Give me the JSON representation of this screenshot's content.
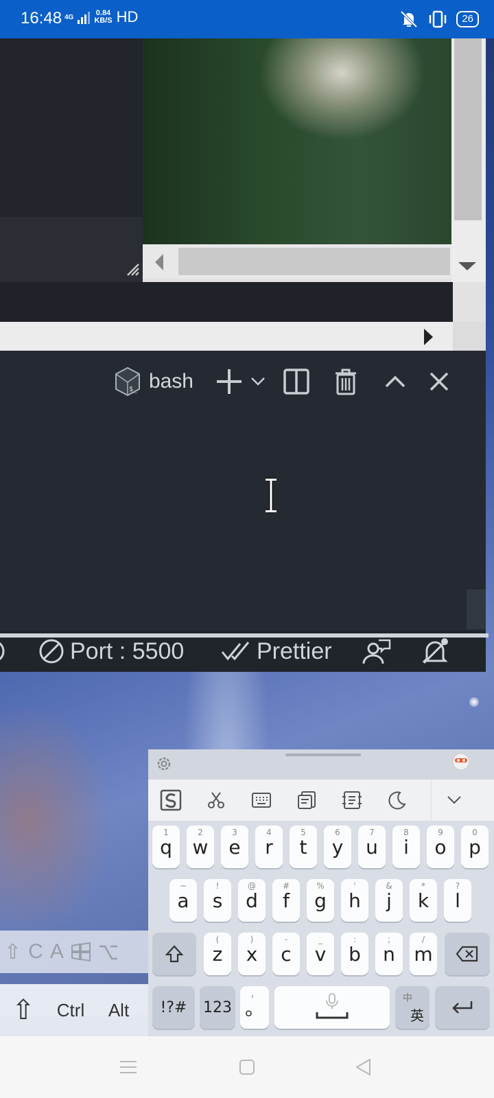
{
  "status_bar": {
    "time": "16:48",
    "network_type": "4G",
    "speed_value": "0.84",
    "speed_unit": "KB/S",
    "hd_label": "HD",
    "battery": "26"
  },
  "terminal": {
    "shell_name": "bash"
  },
  "remote_status_bar": {
    "port_label": "Port : 5500",
    "prettier_label": "Prettier"
  },
  "keyboard": {
    "row1": [
      {
        "key": "q",
        "hint": "1"
      },
      {
        "key": "w",
        "hint": "2"
      },
      {
        "key": "e",
        "hint": "3"
      },
      {
        "key": "r",
        "hint": "4"
      },
      {
        "key": "t",
        "hint": "5"
      },
      {
        "key": "y",
        "hint": "6"
      },
      {
        "key": "u",
        "hint": "7"
      },
      {
        "key": "i",
        "hint": "8"
      },
      {
        "key": "o",
        "hint": "9"
      },
      {
        "key": "p",
        "hint": "0"
      }
    ],
    "row2": [
      {
        "key": "a",
        "hint": "~"
      },
      {
        "key": "s",
        "hint": "!"
      },
      {
        "key": "d",
        "hint": "@"
      },
      {
        "key": "f",
        "hint": "#"
      },
      {
        "key": "g",
        "hint": "%"
      },
      {
        "key": "h",
        "hint": "'"
      },
      {
        "key": "j",
        "hint": "&"
      },
      {
        "key": "k",
        "hint": "*"
      },
      {
        "key": "l",
        "hint": "?"
      }
    ],
    "row3": [
      {
        "key": "z",
        "hint": "("
      },
      {
        "key": "x",
        "hint": ")"
      },
      {
        "key": "c",
        "hint": "-"
      },
      {
        "key": "v",
        "hint": "_"
      },
      {
        "key": "b",
        "hint": ":"
      },
      {
        "key": "n",
        "hint": ";"
      },
      {
        "key": "m",
        "hint": "/"
      }
    ],
    "symbols_key": "!?#",
    "numbers_key": "123",
    "comma_hint": "，",
    "period_key": "。",
    "lang_top": "中",
    "lang_bottom": "英"
  },
  "extra_keys": {
    "row1": [
      "⇧",
      "C",
      "A"
    ],
    "shift": "⇧",
    "ctrl": "Ctrl",
    "alt": "Alt"
  }
}
